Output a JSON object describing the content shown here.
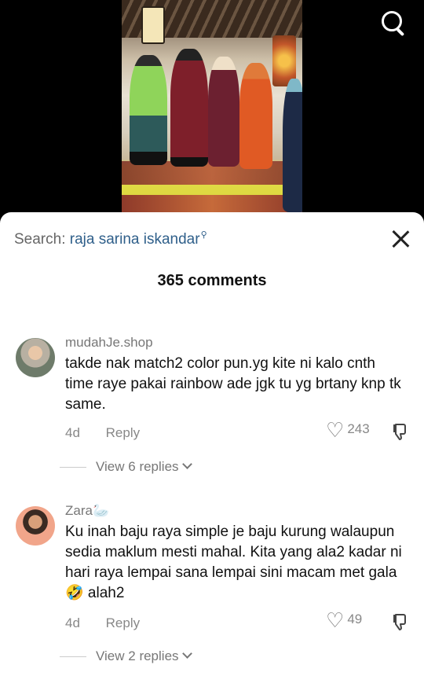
{
  "top_bar": {
    "search_icon": "search-icon"
  },
  "sheet": {
    "search": {
      "prefix": "Search:",
      "term": "raja sarina iskandar",
      "suffix_icon": "search-icon"
    },
    "comment_count": "365 comments",
    "close_icon": "close-icon"
  },
  "comments": [
    {
      "username": "mudahJe.shop",
      "text": "takde nak match2 color pun.yg kite ni kalo cnth time raye pakai rainbow ade jgk tu yg brtany knp tk same.",
      "age": "4d",
      "reply_label": "Reply",
      "likes": "243",
      "view_replies": "View 6 replies"
    },
    {
      "username": "Zara🦢",
      "text": "Ku inah baju raya simple je baju kurung walaupun sedia maklum mesti mahal. Kita yang ala2 kadar ni hari raya lempai sana lempai sini macam met gala 🤣 alah2",
      "age": "4d",
      "reply_label": "Reply",
      "likes": "49",
      "view_replies": "View 2 replies"
    }
  ]
}
